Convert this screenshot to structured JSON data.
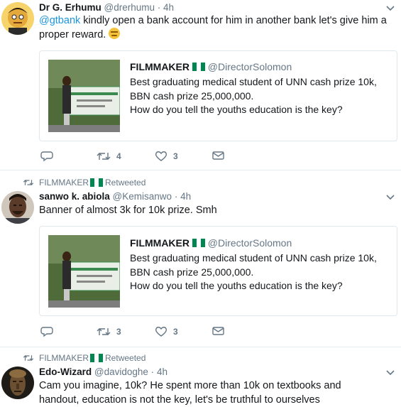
{
  "colors": {
    "accent": "#1b95e0",
    "secondary": "#657786",
    "border": "#e1e8ed",
    "flag_green": "#008751",
    "flag_white": "#ffffff"
  },
  "tweets": [
    {
      "name": "Dr G. Erhumu",
      "handle": "@drerhumu",
      "sep": "·",
      "time": "4h",
      "mention": "@gtbank",
      "text": " kindly open a bank account for him in another bank let's give him a proper reward.",
      "emoji_icon": "expressionless-face-icon",
      "quote": {
        "name": "FILMMAKER",
        "handle": "@DirectorSolomon",
        "line1": "Best graduating medical student of UNN cash prize 10k,",
        "line2": "BBN cash prize 25,000,000.",
        "line3": "How do you tell the youths education is the key?"
      },
      "replies": "",
      "retweets": "4",
      "likes": "3"
    },
    {
      "retweeted_by": "FILMMAKER",
      "retweeted_label": "Retweeted",
      "name": "sanwo k. abiola",
      "handle": "@Kemisanwo",
      "sep": "·",
      "time": "4h",
      "text": "Banner of almost 3k for 10k prize. Smh",
      "quote": {
        "name": "FILMMAKER",
        "handle": "@DirectorSolomon",
        "line1": "Best graduating medical student of UNN cash prize 10k,",
        "line2": "BBN cash prize 25,000,000.",
        "line3": "How do you tell the youths education is the key?"
      },
      "replies": "",
      "retweets": "3",
      "likes": "3"
    },
    {
      "retweeted_by": "FILMMAKER",
      "retweeted_label": "Retweeted",
      "name": "Edo-Wizard",
      "handle": "@davidoghe",
      "sep": "·",
      "time": "4h",
      "text": "Cam you imagine, 10k? He spent more than 10k on textbooks and handout, education is not the key, let's be truthful to ourselves"
    }
  ]
}
